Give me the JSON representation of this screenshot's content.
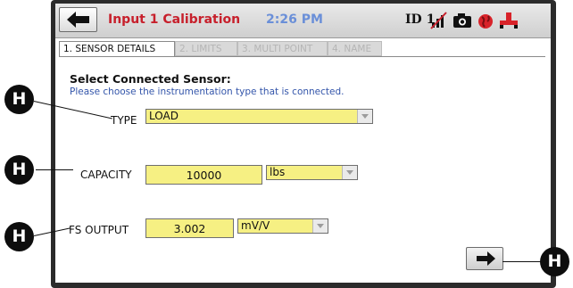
{
  "header": {
    "title": "Input 1 Calibration",
    "time": "2:26 PM",
    "device_id": "ID 1",
    "icons": [
      "back-arrow-icon",
      "no-signal-icon",
      "camera-icon",
      "globe-icon",
      "plug-icon"
    ]
  },
  "tabs": [
    {
      "label": "1. SENSOR DETAILS",
      "active": true
    },
    {
      "label": "2. LIMITS",
      "active": false
    },
    {
      "label": "3. MULTI POINT",
      "active": false
    },
    {
      "label": "4. NAME",
      "active": false
    }
  ],
  "form": {
    "heading": "Select Connected Sensor:",
    "subheading": "Please choose the instrumentation type that is connected.",
    "type_label": "TYPE",
    "type_value": "LOAD",
    "capacity_label": "CAPACITY",
    "capacity_value": "10000",
    "capacity_unit": "lbs",
    "fs_output_label": "FS OUTPUT",
    "fs_output_value": "3.002",
    "fs_output_unit": "mV/V"
  },
  "annotations": {
    "marker_letter": "H"
  },
  "colors": {
    "title": "#c7202c",
    "time": "#6a8fd8",
    "field_fill": "#f6f083",
    "device_frame": "#2b2b2b"
  }
}
